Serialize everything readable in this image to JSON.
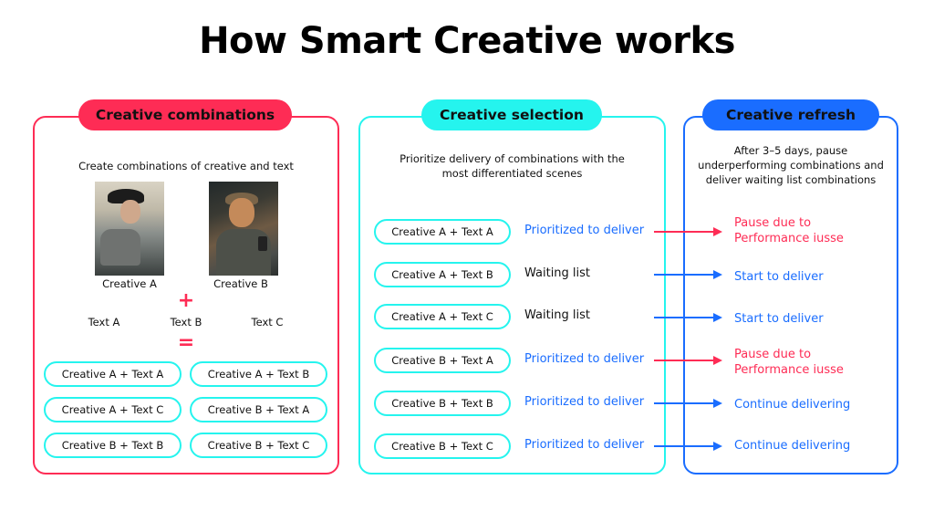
{
  "title": "How Smart Creative works",
  "colors": {
    "combinations": "#fe2c55",
    "selection": "#25f4ee",
    "refresh": "#1a6dff",
    "text": "#111111"
  },
  "combinations_panel": {
    "header": "Creative combinations",
    "description": "Create combinations of creative and text",
    "creatives": [
      {
        "label": "Creative A",
        "image": "man-in-cowboy-hat-in-car-photo"
      },
      {
        "label": "Creative B",
        "image": "smiling-man-looking-at-phone-photo"
      }
    ],
    "plus_symbol": "+",
    "texts": [
      "Text A",
      "Text B",
      "Text C"
    ],
    "equals_symbol": "=",
    "combinations": [
      "Creative A + Text A",
      "Creative A + Text B",
      "Creative A + Text C",
      "Creative B + Text A",
      "Creative B + Text B",
      "Creative B + Text C"
    ]
  },
  "selection_panel": {
    "header": "Creative selection",
    "description_line1": "Prioritize delivery of combinations with the",
    "description_line2": "most differentiated scenes",
    "rows": [
      {
        "combination": "Creative A + Text A",
        "status": "Prioritized to deliver",
        "status_type": "prioritized"
      },
      {
        "combination": "Creative A + Text B",
        "status": "Waiting list",
        "status_type": "waiting"
      },
      {
        "combination": "Creative A + Text C",
        "status": "Waiting list",
        "status_type": "waiting"
      },
      {
        "combination": "Creative B + Text A",
        "status": "Prioritized to deliver",
        "status_type": "prioritized"
      },
      {
        "combination": "Creative B + Text B",
        "status": "Prioritized to deliver",
        "status_type": "prioritized"
      },
      {
        "combination": "Creative B + Text C",
        "status": "Prioritized to deliver",
        "status_type": "prioritized"
      }
    ]
  },
  "refresh_panel": {
    "header": "Creative refresh",
    "description_line1": "After 3–5 days, pause",
    "description_line2": "underperforming combinations and",
    "description_line3": "deliver waiting list combinations",
    "outcomes": [
      {
        "line1": "Pause due to",
        "line2": "Performance iusse",
        "type": "pause",
        "arrow_color": "#fe2c55"
      },
      {
        "line1": "Start to deliver",
        "line2": "",
        "type": "start",
        "arrow_color": "#1a6dff"
      },
      {
        "line1": "Start to deliver",
        "line2": "",
        "type": "start",
        "arrow_color": "#1a6dff"
      },
      {
        "line1": "Pause due to",
        "line2": "Performance iusse",
        "type": "pause",
        "arrow_color": "#fe2c55"
      },
      {
        "line1": "Continue delivering",
        "line2": "",
        "type": "continue",
        "arrow_color": "#1a6dff"
      },
      {
        "line1": "Continue delivering",
        "line2": "",
        "type": "continue",
        "arrow_color": "#1a6dff"
      }
    ]
  }
}
